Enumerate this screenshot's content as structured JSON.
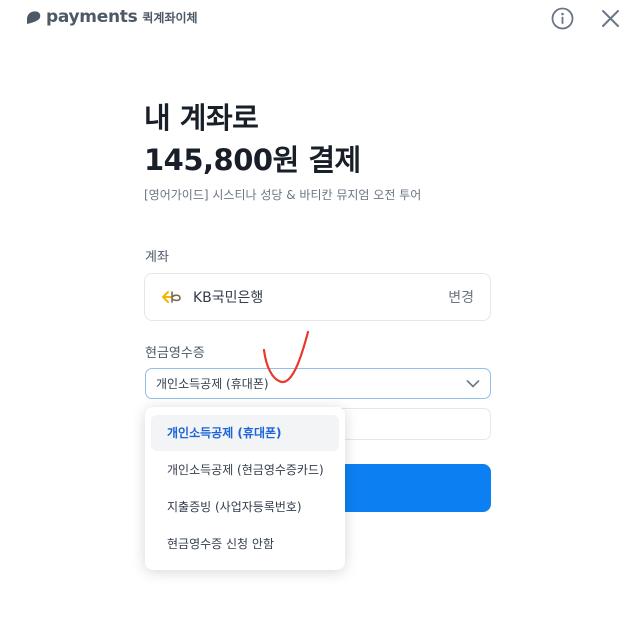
{
  "header": {
    "brand_name": "payments",
    "brand_sub": "퀵계좌이체",
    "info_icon": "info-icon",
    "close_icon": "close-icon"
  },
  "title": {
    "line1": "내 계좌로",
    "line2": "145,800원 결제",
    "subtitle": "[영어가이드] 시스티나 성당 & 바티칸 뮤지엄 오전 투어"
  },
  "account": {
    "label": "계좌",
    "bank_name": "KB국민은행",
    "change_label": "변경",
    "bank_logo_color": "#f5b400"
  },
  "receipt": {
    "label": "현금영수증",
    "selected": "개인소득공제 (휴대폰)",
    "options": [
      "개인소득공제 (휴대폰)",
      "개인소득공제 (현금영수증카드)",
      "지출증빙 (사업자등록번호)",
      "현금영수증 신청 안함"
    ]
  },
  "colors": {
    "accent": "#0c7ff2",
    "selected_text": "#1b64da",
    "annotation": "#e8392b"
  }
}
